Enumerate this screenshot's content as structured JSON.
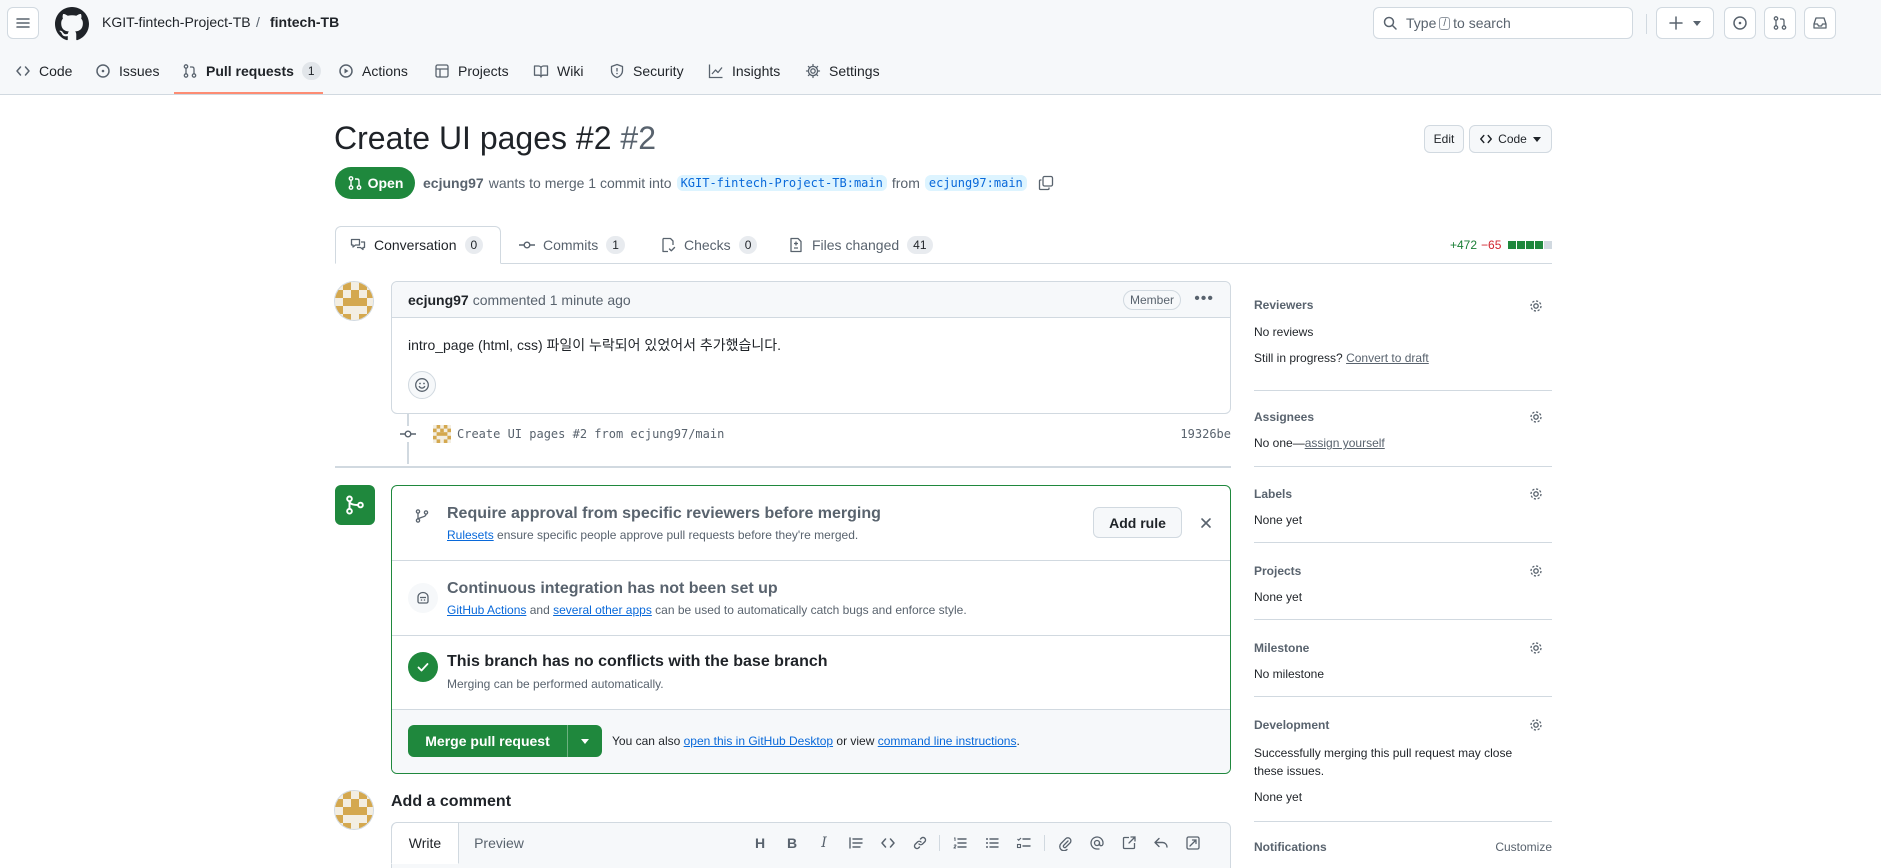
{
  "header": {
    "owner": "KGIT-fintech-Project-TB",
    "separator": "/",
    "repo": "fintech-TB",
    "search_prefix": "Type",
    "search_key": "/",
    "search_suffix": "to search"
  },
  "repo_tabs": [
    {
      "label": "Code",
      "icon": "code-icon"
    },
    {
      "label": "Issues",
      "icon": "issue-icon"
    },
    {
      "label": "Pull requests",
      "icon": "pull-request-icon",
      "count": "1"
    },
    {
      "label": "Actions",
      "icon": "play-icon"
    },
    {
      "label": "Projects",
      "icon": "table-icon"
    },
    {
      "label": "Wiki",
      "icon": "book-icon"
    },
    {
      "label": "Security",
      "icon": "shield-icon"
    },
    {
      "label": "Insights",
      "icon": "graph-icon"
    },
    {
      "label": "Settings",
      "icon": "gear-icon"
    }
  ],
  "pr": {
    "title": "Create UI pages #2",
    "number": "#2",
    "state": "Open",
    "author": "ecjung97",
    "meta_1": "wants to merge 1 commit into",
    "base_branch": "KGIT-fintech-Project-TB:main",
    "meta_2": "from",
    "head_branch": "ecjung97:main",
    "edit_label": "Edit",
    "code_label": "Code"
  },
  "pr_tabs": [
    {
      "label": "Conversation",
      "count": "0",
      "icon": "comment-icon"
    },
    {
      "label": "Commits",
      "count": "1",
      "icon": "commit-icon"
    },
    {
      "label": "Checks",
      "count": "0",
      "icon": "checklist-icon"
    },
    {
      "label": "Files changed",
      "count": "41",
      "icon": "file-diff-icon"
    }
  ],
  "diffstat": {
    "additions": "+472",
    "deletions": "−65"
  },
  "comment": {
    "author": "ecjung97",
    "action": "commented 1 minute ago",
    "role": "Member",
    "body": "intro_page (html, css) 파일이 누락되어 있었어서 추가했습니다."
  },
  "commit": {
    "message": "Create UI pages #2 from ecjung97/main",
    "sha": "19326be"
  },
  "merge": {
    "rule_title": "Require approval from specific reviewers before merging",
    "rule_link": "Rulesets",
    "rule_text": "ensure specific people approve pull requests before they're merged.",
    "add_rule": "Add rule",
    "ci_title": "Continuous integration has not been set up",
    "ci_link1": "GitHub Actions",
    "ci_and": "and",
    "ci_link2": "several other apps",
    "ci_text": "can be used to automatically catch bugs and enforce style.",
    "conflict_title": "This branch has no conflicts with the base branch",
    "conflict_text": "Merging can be performed automatically.",
    "merge_button": "Merge pull request",
    "hint_1": "You can also",
    "hint_link1": "open this in GitHub Desktop",
    "hint_2": "or view",
    "hint_link2": "command line instructions",
    "hint_3": "."
  },
  "add_comment": {
    "title": "Add a comment",
    "write_tab": "Write",
    "preview_tab": "Preview"
  },
  "sidebar": {
    "reviewers_title": "Reviewers",
    "reviewers_value": "No reviews",
    "reviewers_progress": "Still in progress?",
    "reviewers_link": "Convert to draft",
    "assignees_title": "Assignees",
    "assignees_value": "No one—",
    "assignees_link": "assign yourself",
    "labels_title": "Labels",
    "labels_value": "None yet",
    "projects_title": "Projects",
    "projects_value": "None yet",
    "milestone_title": "Milestone",
    "milestone_value": "No milestone",
    "development_title": "Development",
    "development_text": "Successfully merging this pull request may close these issues.",
    "development_value": "None yet",
    "notifications_title": "Notifications",
    "notifications_link": "Customize"
  },
  "colors": {
    "accent_green": "#1f883d",
    "link_blue": "#0969da",
    "tab_underline": "#fd8c73",
    "deletion_red": "#d1242f"
  }
}
